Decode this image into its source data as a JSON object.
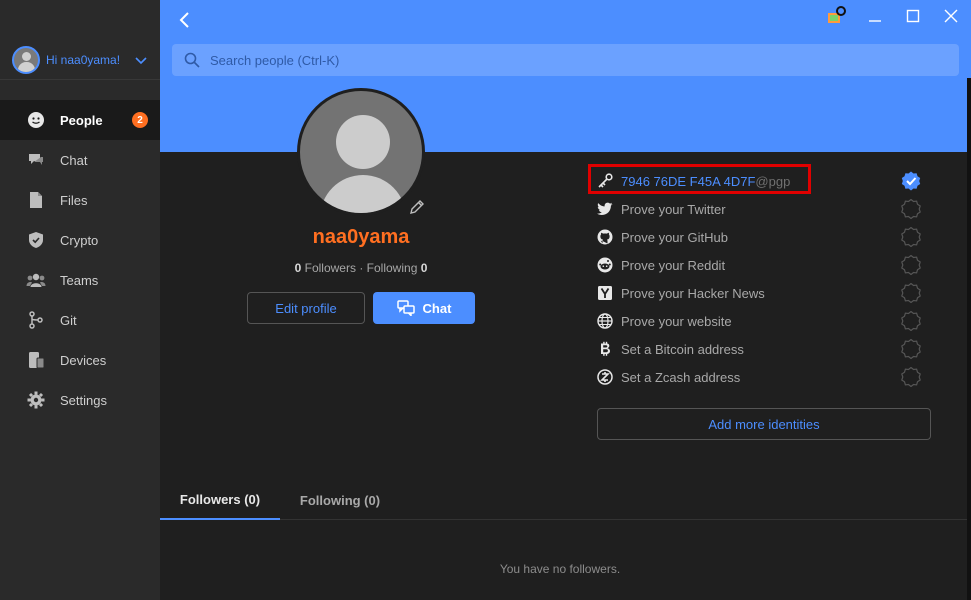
{
  "user_header": {
    "greeting": "Hi naa0yama!"
  },
  "search": {
    "placeholder": "Search people (Ctrl-K)"
  },
  "nav": {
    "items": [
      {
        "label": "People",
        "badge": "2"
      },
      {
        "label": "Chat"
      },
      {
        "label": "Files"
      },
      {
        "label": "Crypto"
      },
      {
        "label": "Teams"
      },
      {
        "label": "Git"
      },
      {
        "label": "Devices"
      },
      {
        "label": "Settings"
      }
    ]
  },
  "profile": {
    "username": "naa0yama",
    "followers_count": "0",
    "followers_label": "Followers",
    "separator": "·",
    "following_label": "Following",
    "following_count": "0",
    "edit_label": "Edit profile",
    "chat_label": "Chat"
  },
  "identities": {
    "pgp_key": "7946 76DE F45A 4D7F",
    "pgp_suffix": "@pgp",
    "items": [
      "Prove your Twitter",
      "Prove your GitHub",
      "Prove your Reddit",
      "Prove your Hacker News",
      "Prove your website",
      "Set a Bitcoin address",
      "Set a Zcash address"
    ],
    "add_label": "Add more identities"
  },
  "tabs": {
    "followers": "Followers (0)",
    "following": "Following (0)"
  },
  "empty_message": "You have no followers.",
  "colors": {
    "accent": "#4c8eff",
    "username": "#ff6f21",
    "badge": "#ff6f21",
    "highlight": "#e00000"
  }
}
